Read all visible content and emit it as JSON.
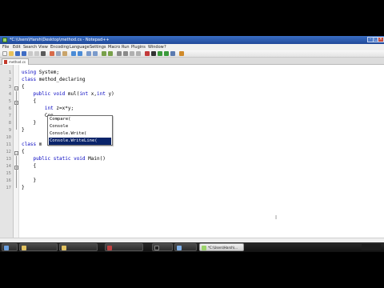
{
  "window": {
    "title": "*C:\\Users\\Harsh\\Desktop\\method.cs - Notepad++",
    "controls": {
      "minimize": "–",
      "maximize": "□",
      "close": "×"
    }
  },
  "menu": [
    "File",
    "Edit",
    "Search",
    "View",
    "Encoding",
    "Language",
    "Settings",
    "Macro",
    "Run",
    "Plugins",
    "Window",
    "?"
  ],
  "tab": {
    "label": "method.cs"
  },
  "editor": {
    "line_numbers": [
      "1",
      "2",
      "3",
      "4",
      "5",
      "6",
      "7",
      "8",
      "9",
      "10",
      "11",
      "12",
      "13",
      "14",
      "15",
      "16",
      "17"
    ],
    "lines": [
      "using System;",
      "class method_declaring",
      "{",
      "    public void mul(int x,int y)",
      "    {",
      "        int z=x*y;",
      "        Con",
      "    }",
      "}",
      "",
      "class m",
      "{",
      "    public static void Main()",
      "    {",
      "",
      "    }",
      "}"
    ]
  },
  "autocomplete": {
    "items": [
      "Compare(",
      "Console",
      "Console.Write(",
      "Console.WriteLine("
    ],
    "selected_index": 3
  },
  "taskbar": {
    "active_label": "*C:\\Users\\Harsh\\..."
  },
  "colors": {
    "keyword": "#0000c0",
    "selection": "#0a246a",
    "title_bar": "#2a5bb0"
  }
}
